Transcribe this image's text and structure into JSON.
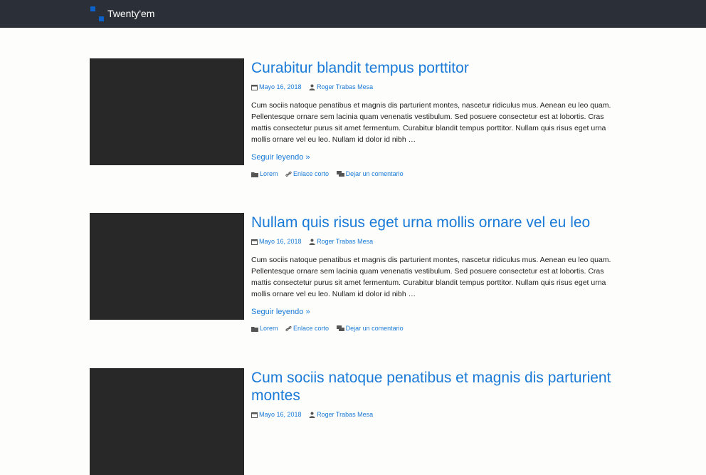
{
  "site": {
    "title": "Twenty'em"
  },
  "posts": [
    {
      "title": "Curabitur blandit tempus porttitor",
      "date": "Mayo 16, 2018",
      "author": "Roger Trabas Mesa",
      "excerpt": "Cum sociis natoque penatibus et magnis dis parturient montes, nascetur ridiculus mus. Aenean eu leo quam. Pellentesque ornare sem lacinia quam venenatis vestibulum. Sed posuere consectetur est at lobortis. Cras mattis consectetur purus sit amet fermentum. Curabitur blandit tempus porttitor. Nullam quis risus eget urna mollis ornare vel eu leo. Nullam id dolor id nibh …",
      "read_more": "Seguir leyendo »",
      "category": "Lorem",
      "shortlink": "Enlace corto",
      "comments": "Dejar un comentario"
    },
    {
      "title": "Nullam quis risus eget urna mollis ornare vel eu leo",
      "date": "Mayo 16, 2018",
      "author": "Roger Trabas Mesa",
      "excerpt": "Cum sociis natoque penatibus et magnis dis parturient montes, nascetur ridiculus mus. Aenean eu leo quam. Pellentesque ornare sem lacinia quam venenatis vestibulum. Sed posuere consectetur est at lobortis. Cras mattis consectetur purus sit amet fermentum. Curabitur blandit tempus porttitor. Nullam quis risus eget urna mollis ornare vel eu leo. Nullam id dolor id nibh …",
      "read_more": "Seguir leyendo »",
      "category": "Lorem",
      "shortlink": "Enlace corto",
      "comments": "Dejar un comentario"
    },
    {
      "title": "Cum sociis natoque penatibus et magnis dis parturient montes",
      "date": "Mayo 16, 2018",
      "author": "Roger Trabas Mesa"
    }
  ],
  "colors": {
    "accent": "#1a7ad8",
    "header_bg": "#2b3038",
    "thumb_bg": "#282828",
    "logo": "#0d62c9"
  },
  "icons": {
    "date": "calendar-icon",
    "author": "user-icon",
    "category": "folder-icon",
    "shortlink": "link-icon",
    "comments": "comments-icon"
  }
}
